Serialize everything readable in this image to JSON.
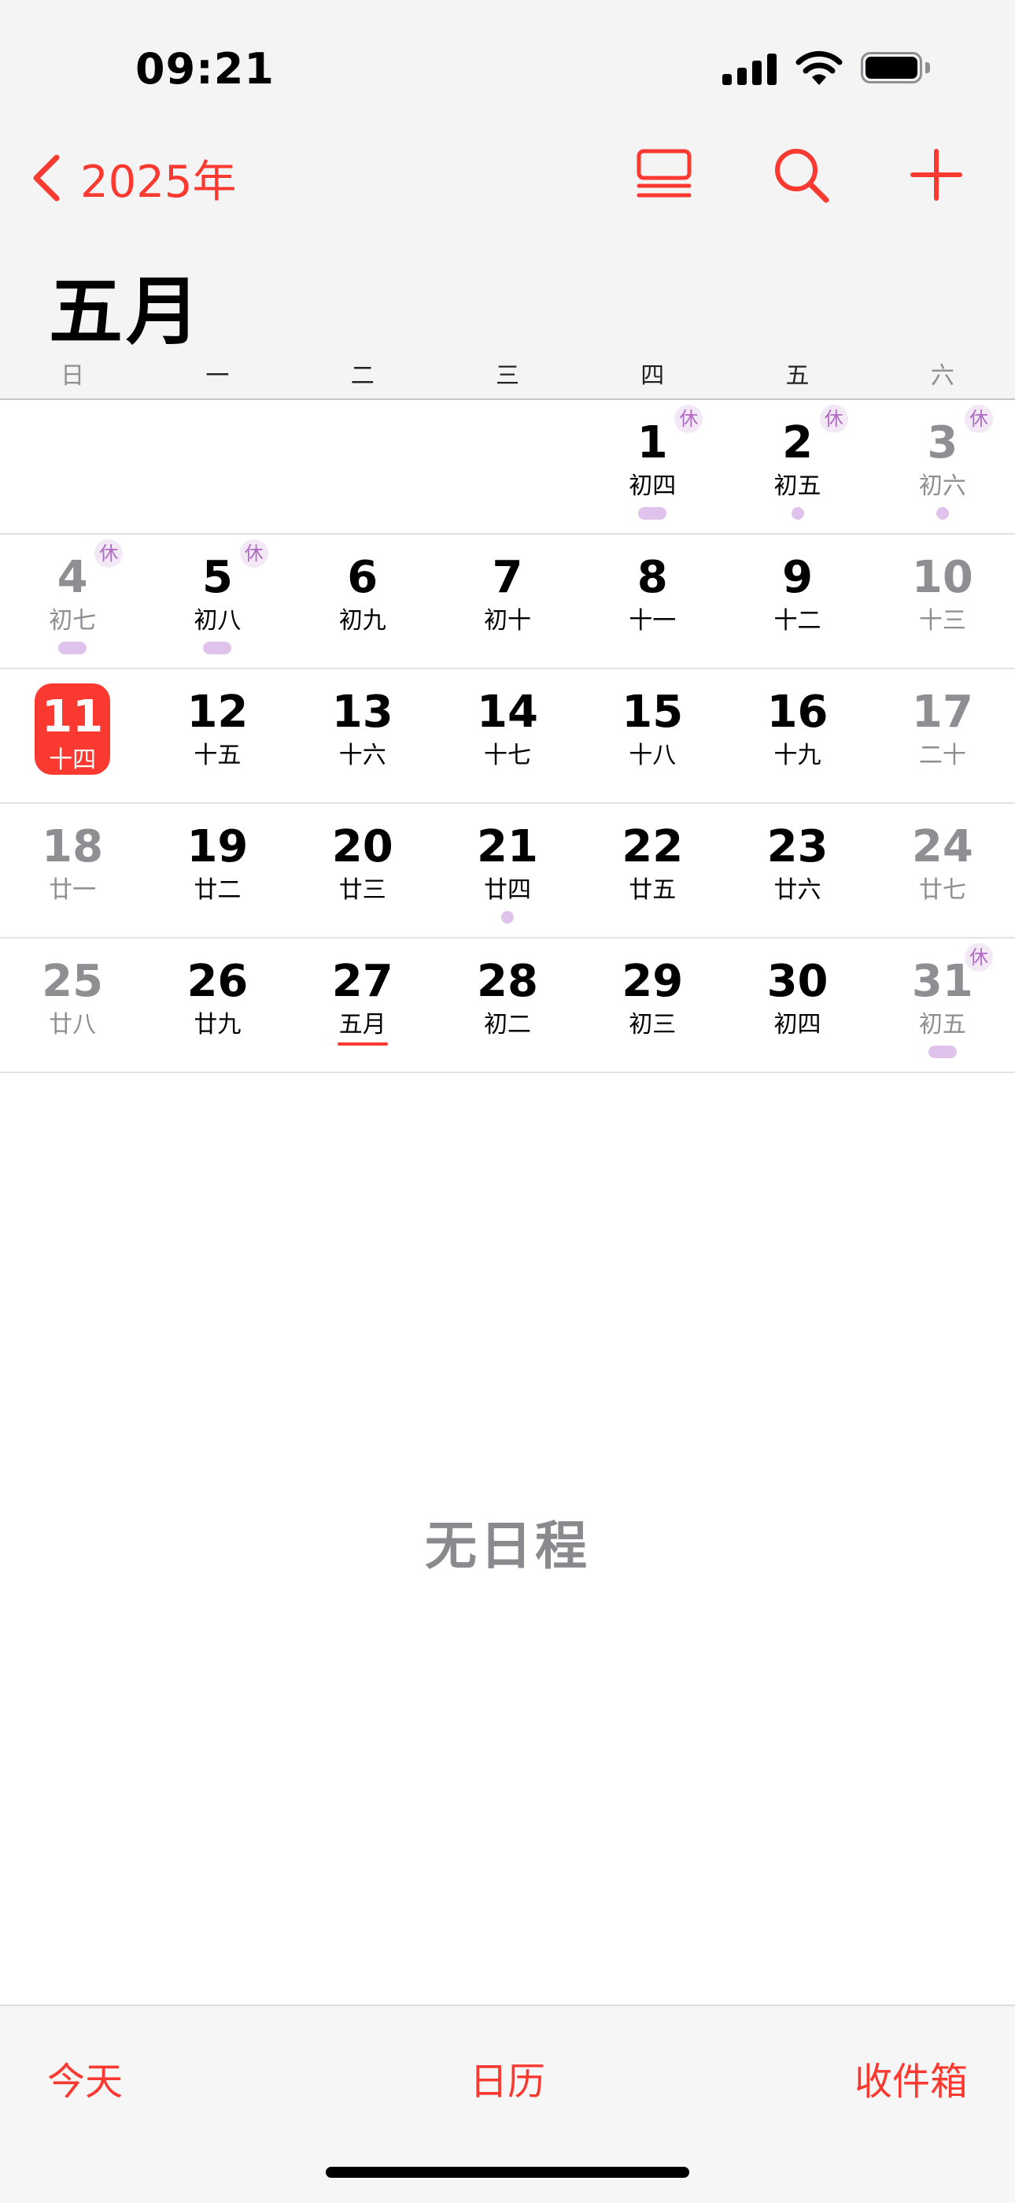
{
  "status_bar": {
    "time": "09:21",
    "icons": [
      "cellular-signal-icon",
      "wifi-icon",
      "battery-icon"
    ]
  },
  "nav": {
    "back_label": "2025年",
    "actions": [
      "list-view-icon",
      "search-icon",
      "add-icon"
    ]
  },
  "month_title": "五月",
  "weekdays": [
    "日",
    "一",
    "二",
    "三",
    "四",
    "五",
    "六"
  ],
  "weeks": [
    [
      {
        "day": "",
        "lunar": ""
      },
      {
        "day": "",
        "lunar": ""
      },
      {
        "day": "",
        "lunar": ""
      },
      {
        "day": "",
        "lunar": ""
      },
      {
        "day": "1",
        "lunar": "初四",
        "rest": "休",
        "event": "pill"
      },
      {
        "day": "2",
        "lunar": "初五",
        "rest": "休",
        "event": "dot"
      },
      {
        "day": "3",
        "lunar": "初六",
        "rest": "休",
        "event": "dot",
        "weekend": true
      }
    ],
    [
      {
        "day": "4",
        "lunar": "初七",
        "rest": "休",
        "event": "pill",
        "weekend": true
      },
      {
        "day": "5",
        "lunar": "初八",
        "rest": "休",
        "event": "pill"
      },
      {
        "day": "6",
        "lunar": "初九"
      },
      {
        "day": "7",
        "lunar": "初十"
      },
      {
        "day": "8",
        "lunar": "十一"
      },
      {
        "day": "9",
        "lunar": "十二"
      },
      {
        "day": "10",
        "lunar": "十三",
        "weekend": true
      }
    ],
    [
      {
        "day": "11",
        "lunar": "十四",
        "today": true
      },
      {
        "day": "12",
        "lunar": "十五"
      },
      {
        "day": "13",
        "lunar": "十六"
      },
      {
        "day": "14",
        "lunar": "十七"
      },
      {
        "day": "15",
        "lunar": "十八"
      },
      {
        "day": "16",
        "lunar": "十九"
      },
      {
        "day": "17",
        "lunar": "二十",
        "weekend": true
      }
    ],
    [
      {
        "day": "18",
        "lunar": "廿一",
        "weekend": true
      },
      {
        "day": "19",
        "lunar": "廿二"
      },
      {
        "day": "20",
        "lunar": "廿三"
      },
      {
        "day": "21",
        "lunar": "廿四",
        "event": "dot"
      },
      {
        "day": "22",
        "lunar": "廿五"
      },
      {
        "day": "23",
        "lunar": "廿六"
      },
      {
        "day": "24",
        "lunar": "廿七",
        "weekend": true
      }
    ],
    [
      {
        "day": "25",
        "lunar": "廿八",
        "weekend": true
      },
      {
        "day": "26",
        "lunar": "廿九"
      },
      {
        "day": "27",
        "lunar": "五月",
        "underline": true
      },
      {
        "day": "28",
        "lunar": "初二"
      },
      {
        "day": "29",
        "lunar": "初三"
      },
      {
        "day": "30",
        "lunar": "初四"
      },
      {
        "day": "31",
        "lunar": "初五",
        "rest": "休",
        "event": "pill",
        "weekend": true
      }
    ]
  ],
  "empty_label": "无日程",
  "tabbar": {
    "today": "今天",
    "calendars": "日历",
    "inbox": "收件箱"
  },
  "colors": {
    "accent": "#fa3a31",
    "event": "#e0c3ec",
    "rest_badge_text": "#b06bc2",
    "muted": "#8e8e93"
  }
}
